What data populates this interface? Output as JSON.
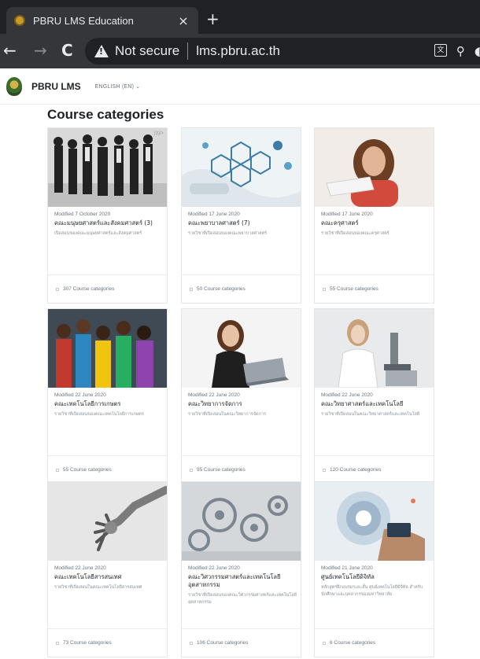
{
  "browser": {
    "tab_title": "PBRU LMS Education",
    "tab_close": "×",
    "new_tab": "+",
    "back": "←",
    "forward": "→",
    "reload": "C",
    "security_label": "Not secure",
    "url": "lms.pbru.ac.th",
    "icons": [
      "translate-icon",
      "zoom-icon",
      "eye-off-icon"
    ]
  },
  "site": {
    "name": "PBRU LMS",
    "language": "ENGLISH (EN) ⌄"
  },
  "page": {
    "heading": "Course categories"
  },
  "cards": [
    {
      "date": "Modified 7 October 2020",
      "title": "คณะมนุษยศาสตร์และสังคมศาสตร์ (3)",
      "desc": "เปิดสอนของคณะมนุษยศาสตร์และสังคมศาสตร์",
      "footer": "307 Course categories",
      "badge": "(3)/>"
    },
    {
      "date": "Modified 17 June 2020",
      "title": "คณะพยาบาลศาสตร์ (7)",
      "desc": "รายวิชาที่เปิดสอนของคณะพยาบาลศาสตร์",
      "footer": "50 Course categories"
    },
    {
      "date": "Modified 17 June 2020",
      "title": "คณะครุศาสตร์",
      "desc": "รายวิชาที่เปิดสอนของคณะครุศาสตร์",
      "footer": "55 Course categories"
    },
    {
      "date": "Modified 22 June 2020",
      "title": "คณะเทคโนโลยีการเกษตร",
      "desc": "รายวิชาที่เปิดสอนของคณะเทคโนโลยีการเกษตร",
      "footer": "55 Course categories"
    },
    {
      "date": "Modified 22 June 2020",
      "title": "คณะวิทยาการจัดการ",
      "desc": "รายวิชาที่เปิดสอนในคณะวิทยาการจัดการ",
      "footer": "95 Course categories"
    },
    {
      "date": "Modified 22 June 2020",
      "title": "คณะวิทยาศาสตร์และเทคโนโลยี",
      "desc": "รายวิชาที่เปิดสอนในคณะวิทยาศาสตร์และเทคโนโลยี",
      "footer": "120 Course categories"
    },
    {
      "date": "Modified 22 June 2020",
      "title": "คณะเทคโนโลยีสารสนเทศ",
      "desc": "รายวิชาที่เปิดสอนในคณะเทคโนโลยีสารสนเทศ",
      "footer": "73 Course categories"
    },
    {
      "date": "Modified 22 June 2020",
      "title": "คณะวิศวกรรมศาสตร์และเทคโนโลยีอุตสาหกรรม",
      "desc": "รายวิชาที่เปิดสอนของคณะวิศวกรรมศาสตร์และเทคโนโลยีอุตสาหกรรม",
      "footer": "106 Course categories"
    },
    {
      "date": "Modified 21 June 2020",
      "title": "ศูนย์เทคโนโลยีดิจิทัล",
      "desc": "หลักสูตรฝึกอบรมระยะสั้น ศูนย์เทคโนโลยีดิจิทัล สำหรับนักศึกษาและบุคลากรของมหาวิทยาลัย",
      "footer": "6 Course categories"
    }
  ],
  "colors": {
    "chrome_dark": "#202124",
    "chrome_mid": "#35363a",
    "text_primary": "#1d2125",
    "text_muted": "#6a737b"
  }
}
